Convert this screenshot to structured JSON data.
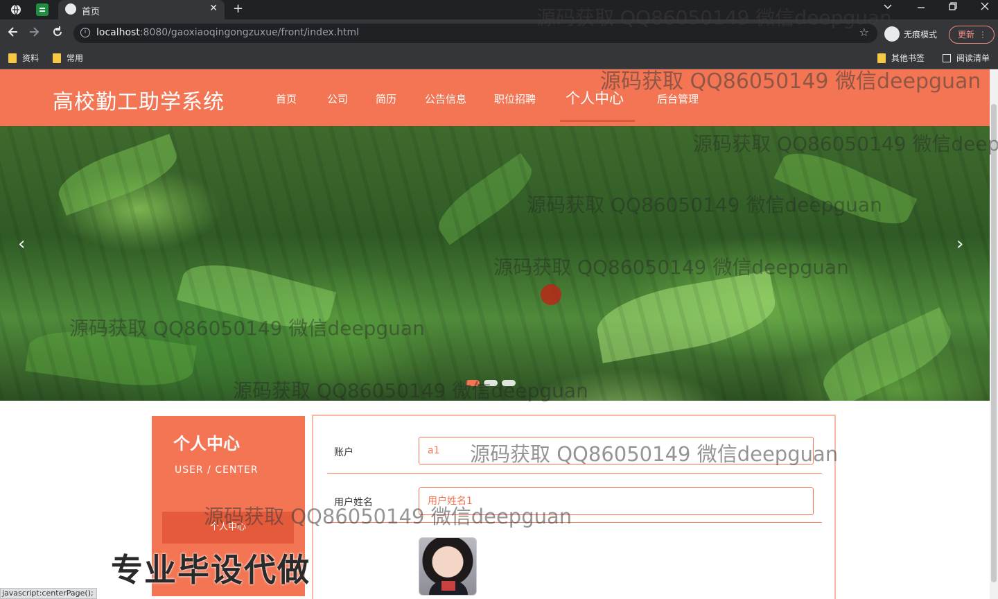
{
  "browser": {
    "tab_title": "首页",
    "url_host": "localhost",
    "url_path": ":8080/gaoxiaoqingongzuxue/front/index.html",
    "incognito_label": "无痕模式",
    "update_label": "更新",
    "bookmarks": [
      "资料",
      "常用"
    ],
    "other_bookmarks": "其他书签",
    "reading_list": "阅读清单",
    "new_tab_symbol": "+",
    "close_symbol": "✕",
    "status_text": "javascript:centerPage();"
  },
  "site": {
    "title": "高校勤工助学系统",
    "nav": [
      "首页",
      "公司",
      "简历",
      "公告信息",
      "职位招聘",
      "个人中心",
      "后台管理"
    ],
    "active_nav": "个人中心"
  },
  "banner": {
    "prev_symbol": "‹",
    "next_symbol": "›",
    "slide_count": 3,
    "active_slide": 1
  },
  "sidebar": {
    "title": "个人中心",
    "subtitle": "USER / CENTER",
    "menu_item": "个人中心"
  },
  "form": {
    "account_label": "账户",
    "account_value": "a1",
    "username_label": "用户姓名",
    "username_value": "用户姓名1"
  },
  "overlay": {
    "watermark": "源码获取 QQ86050149 微信deepguan",
    "promo": "专业毕设代做"
  },
  "colors": {
    "brand": "#f47553",
    "browser_dark": "#202124",
    "update_accent": "#f28b82"
  }
}
